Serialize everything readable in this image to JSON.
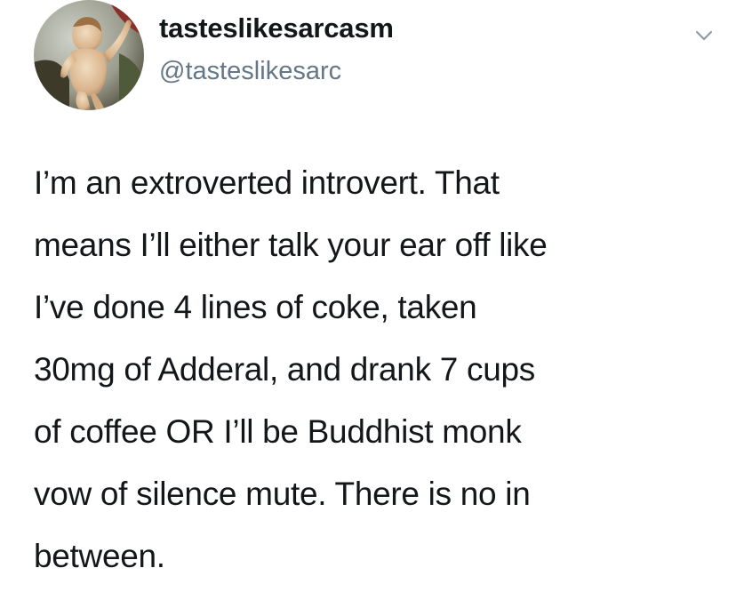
{
  "user": {
    "display_name": "tasteslikesarcasm",
    "handle": "@tasteslikesarc",
    "avatar_icon": "cherub-painting-avatar"
  },
  "menu": {
    "icon": "chevron-down-icon"
  },
  "tweet": {
    "lines": [
      "I’m an extroverted introvert. That",
      "means I’ll either talk your ear off like",
      "I’ve done 4 lines of coke, taken",
      "30mg of Adderal, and drank 7 cups",
      "of coffee OR I’ll be Buddhist monk",
      "vow of silence mute. There is no in",
      "between."
    ]
  },
  "colors": {
    "text": "#14171a",
    "handle": "#657786",
    "background": "#ffffff"
  }
}
